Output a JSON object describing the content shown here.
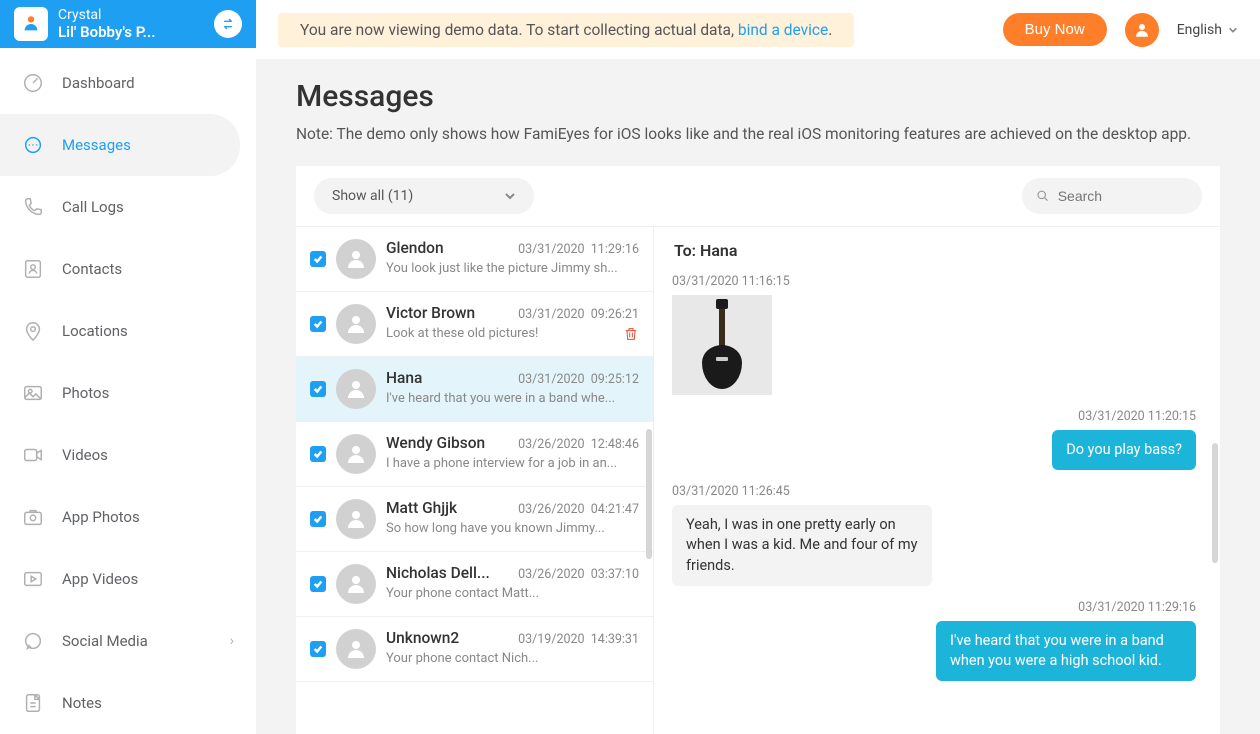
{
  "header": {
    "user_name": "Crystal",
    "device_name": "Lil' Bobby's P..."
  },
  "topbar": {
    "banner_prefix": "You are now viewing demo data. To start collecting actual data, ",
    "banner_link": "bind a device",
    "banner_suffix": ".",
    "buy_label": "Buy Now",
    "language": "English"
  },
  "sidebar": {
    "items": [
      {
        "label": "Dashboard"
      },
      {
        "label": "Messages"
      },
      {
        "label": "Call Logs"
      },
      {
        "label": "Contacts"
      },
      {
        "label": "Locations"
      },
      {
        "label": "Photos"
      },
      {
        "label": "Videos"
      },
      {
        "label": "App Photos"
      },
      {
        "label": "App Videos"
      },
      {
        "label": "Social Media"
      },
      {
        "label": "Notes"
      }
    ]
  },
  "page": {
    "title": "Messages",
    "note": "Note: The demo only shows how FamiEyes for iOS looks like and the real iOS monitoring features are achieved on the desktop app."
  },
  "filter": {
    "label": "Show all (11)"
  },
  "search": {
    "placeholder": "Search"
  },
  "conversations": [
    {
      "name": "Glendon",
      "date": "03/31/2020",
      "time": "11:29:16",
      "preview": "You look just like the picture Jimmy sh..."
    },
    {
      "name": "Victor Brown",
      "date": "03/31/2020",
      "time": "09:26:21",
      "preview": "Look at these old pictures!",
      "trash": true
    },
    {
      "name": "Hana",
      "date": "03/31/2020",
      "time": "09:25:12",
      "preview": "I've heard that you were in a band whe...",
      "selected": true
    },
    {
      "name": "Wendy Gibson",
      "date": "03/26/2020",
      "time": "12:48:46",
      "preview": "I have a phone interview for a job in an..."
    },
    {
      "name": "Matt Ghjjk",
      "date": "03/26/2020",
      "time": "04:21:47",
      "preview": "So how long have you known Jimmy..."
    },
    {
      "name": "Nicholas Dell...",
      "date": "03/26/2020",
      "time": "03:37:10",
      "preview": "Your phone contact Matt..."
    },
    {
      "name": "Unknown2",
      "date": "03/19/2020",
      "time": "14:39:31",
      "preview": "Your phone contact Nich..."
    }
  ],
  "thread": {
    "to_label": "To: Hana",
    "messages": [
      {
        "side": "left",
        "time": "03/31/2020  11:16:15",
        "type": "image"
      },
      {
        "side": "right",
        "time": "03/31/2020  11:20:15",
        "text": "Do you play bass?"
      },
      {
        "side": "left",
        "time": "03/31/2020  11:26:45",
        "text": "Yeah, I was in one pretty early on when I was a kid. Me and four of my friends."
      },
      {
        "side": "right",
        "time": "03/31/2020  11:29:16",
        "text": "I've heard that you were in a band when you were a high school kid."
      }
    ]
  }
}
